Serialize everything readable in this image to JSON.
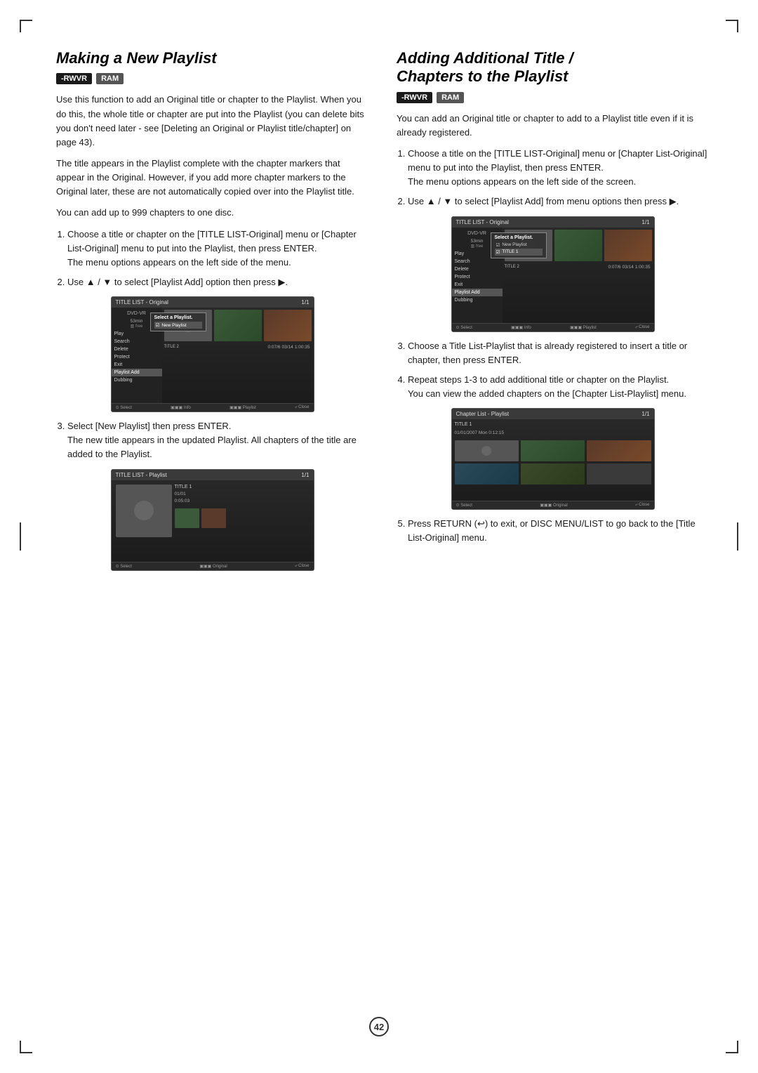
{
  "page": {
    "number": "42",
    "background": "#ffffff"
  },
  "left_section": {
    "title": "Making a New Playlist",
    "badges": [
      {
        "label": "-RWVR",
        "class": "badge-rwvr"
      },
      {
        "label": "RAM",
        "class": "badge-ram"
      }
    ],
    "intro_text": "Use this function to add an Original title or chapter to the Playlist. When you do this, the whole title or chapter are put into the Playlist (you can delete bits you don't need later - see [Deleting an Original or Playlist title/chapter] on page 43).",
    "body_text_2": "The title appears in the Playlist complete with the chapter markers that appear in the Original. However, if you add more chapter markers to the Original later, these are not automatically copied over into the Playlist title.",
    "body_text_3": "You can add up to 999 chapters to one disc.",
    "steps": [
      {
        "num": 1,
        "text": "Choose a title or chapter on the [TITLE LIST-Original] menu or [Chapter List-Original] menu to put into the Playlist, then press ENTER.\nThe menu options appears on the left side of the menu."
      },
      {
        "num": 2,
        "text": "Use ▲ / ▼ to select [Playlist Add] option then press ►."
      },
      {
        "num": 3,
        "text": "Select [New Playlist] then press ENTER.\nThe new title appears in the updated Playlist. All chapters of the title are added to the Playlist."
      }
    ],
    "screen1": {
      "header_left": "TITLE LIST - Original",
      "header_right": "1/1",
      "dvd_label": "DVD-VR",
      "dvd_info": "53min",
      "dvd_free": "free",
      "sidebar_items": [
        "Play",
        "Search",
        "Delete",
        "Protect",
        "Exit",
        "Playlist Add",
        "Dubbing"
      ],
      "popup_title": "Select a Playlist.",
      "popup_items": [
        "New Playlist ☑",
        ""
      ],
      "title2_label": "TITLE 2",
      "title2_time": "0:07/6  03/14  1:00:35",
      "footer_items": [
        "Select",
        "INFO Info",
        "REC Playlist",
        "Close"
      ]
    },
    "screen2": {
      "header_left": "TITLE LIST - Playlist",
      "header_right": "1/1",
      "title1_label": "TITLE 1",
      "title1_date": "01/01",
      "title1_time": "0:05:03",
      "footer_items": [
        "Select",
        "MENU Original",
        "Close"
      ]
    }
  },
  "right_section": {
    "title_line1": "Adding Additional Title /",
    "title_line2": "Chapters to the Playlist",
    "badges": [
      {
        "label": "-RWVR",
        "class": "badge-rwvr"
      },
      {
        "label": "RAM",
        "class": "badge-ram"
      }
    ],
    "intro_text": "You can add an Original title or chapter to add to a Playlist title even if it is already registered.",
    "steps": [
      {
        "num": 1,
        "text": "Choose a title on the [TITLE LIST-Original] menu or [Chapter List-Original] menu to put into the Playlist, then press ENTER.\nThe menu options appears on the left side of the screen."
      },
      {
        "num": 2,
        "text": "Use ▲ / ▼ to select [Playlist Add] from menu options then press ►."
      },
      {
        "num": 3,
        "text": "Choose a Title List-Playlist that is already registered to insert a title or chapter, then press ENTER."
      },
      {
        "num": 4,
        "text": "Repeat steps 1-3 to add additional title or chapter on the Playlist.\nYou can view the added chapters on the [Chapter List-Playlist] menu."
      },
      {
        "num": 5,
        "text": "Press RETURN (↩) to exit, or DISC MENU/LIST to go back to the [Title List-Original] menu."
      }
    ],
    "screen1": {
      "header_left": "TITLE LIST - Original",
      "header_right": "1/1",
      "dvd_label": "DVD-VR",
      "dvd_info": "53min",
      "dvd_free": "free",
      "sidebar_items": [
        "Play",
        "Search",
        "Delete",
        "Protect",
        "Exit",
        "Playlist Add",
        "Dubbing"
      ],
      "popup_title": "Select a Playlist.",
      "popup_items": [
        "New Playlist ☑",
        "TITLE 1 ☑"
      ],
      "title2_label": "TITLE 2",
      "title2_time": "0:07/6  03/14  1:00:35",
      "footer_items": [
        "Select",
        "INFO Info",
        "REC Playlist",
        "Close"
      ]
    },
    "screen2": {
      "header_left": "Chapter List - Playlist",
      "header_right": "1/1",
      "title_label": "TITLE 1",
      "date_label": "01/01/2007 Mon  0:12:15",
      "footer_items": [
        "Select",
        "MENU Original",
        "Close"
      ]
    }
  }
}
